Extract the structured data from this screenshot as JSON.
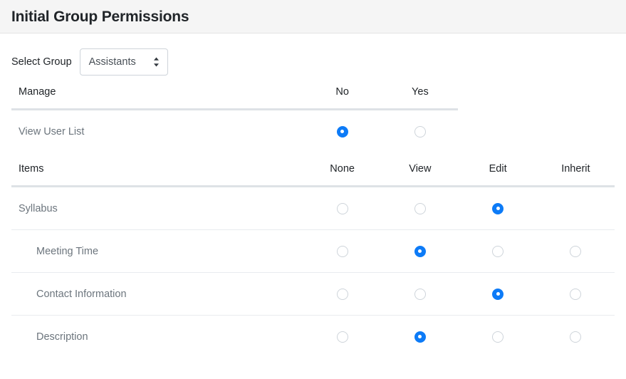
{
  "header": {
    "title": "Initial Group Permissions"
  },
  "select_group": {
    "label": "Select Group",
    "value": "Assistants",
    "icon": "updown-chevron-icon"
  },
  "colors": {
    "accent": "#0d7bf7",
    "header_bg": "#f5f5f5",
    "rule": "#dee2e6",
    "row_border": "#e9ecef",
    "label_text": "#6c757d",
    "title_text": "#212529"
  },
  "sections": [
    {
      "id": "manage",
      "label": "Manage",
      "options": [
        "No",
        "Yes"
      ],
      "rows": [
        {
          "label": "View User List",
          "indent": false,
          "selected": "No"
        }
      ]
    },
    {
      "id": "items",
      "label": "Items",
      "options": [
        "None",
        "View",
        "Edit",
        "Inherit"
      ],
      "rows": [
        {
          "label": "Syllabus",
          "indent": false,
          "selected": "Edit",
          "available": [
            "None",
            "View",
            "Edit"
          ]
        },
        {
          "label": "Meeting Time",
          "indent": true,
          "selected": "View",
          "available": [
            "None",
            "View",
            "Edit",
            "Inherit"
          ]
        },
        {
          "label": "Contact Information",
          "indent": true,
          "selected": "Edit",
          "available": [
            "None",
            "View",
            "Edit",
            "Inherit"
          ]
        },
        {
          "label": "Description",
          "indent": true,
          "selected": "View",
          "available": [
            "None",
            "View",
            "Edit",
            "Inherit"
          ]
        }
      ]
    }
  ]
}
